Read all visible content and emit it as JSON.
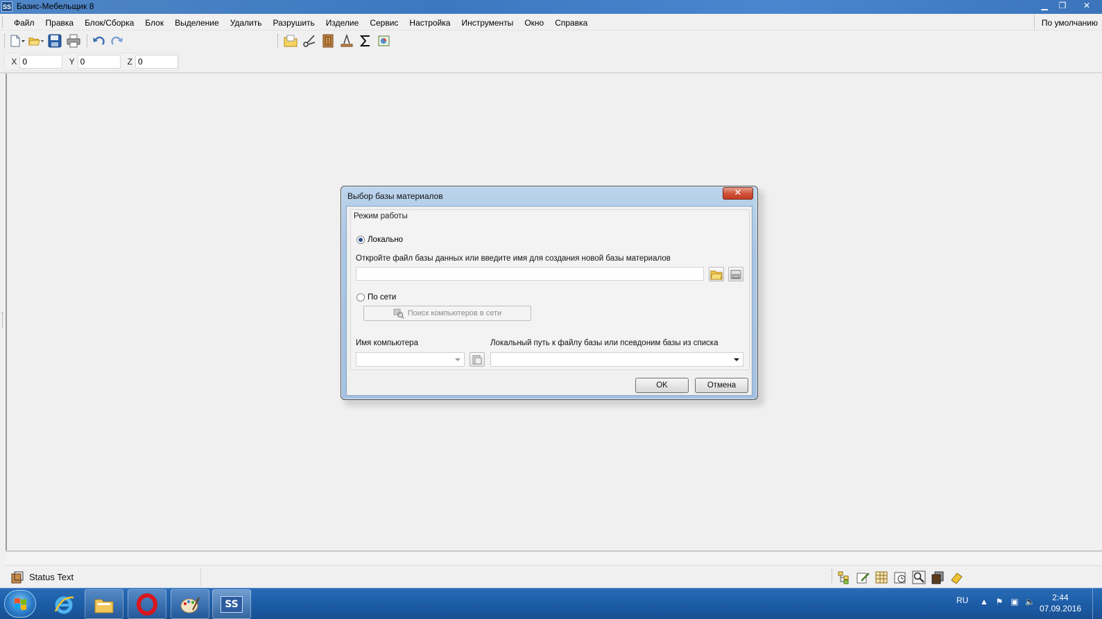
{
  "window": {
    "app_icon_text": "SS",
    "title": "Базис-Мебельщик 8",
    "minimize": "▁",
    "restore": "❐",
    "close": "✕"
  },
  "menu": {
    "items": [
      "Файл",
      "Правка",
      "Блок/Сборка",
      "Блок",
      "Выделение",
      "Удалить",
      "Разрушить",
      "Изделие",
      "Сервис",
      "Настройка",
      "Инструменты",
      "Окно",
      "Справка"
    ],
    "right_label": "По умолчанию"
  },
  "coords": {
    "x_label": "X",
    "x_value": "0",
    "y_label": "Y",
    "y_value": "0",
    "z_label": "Z",
    "z_value": "0"
  },
  "dialog": {
    "title": "Выбор базы материалов",
    "close_label": "✕",
    "group_title": "Режим работы",
    "local_label": "Локально",
    "local_selected": true,
    "open_file_label": "Откройте файл базы данных или введите имя для создания новой базы материалов",
    "file_value": "",
    "network_label": "По сети",
    "search_button": "Поиск компьютеров в сети",
    "computer_name_label": "Имя компьютера",
    "computer_value": "",
    "local_path_label": "Локальный путь к файлу базы или псевдоним базы из списка",
    "path_value": "",
    "ok_label": "OK",
    "cancel_label": "Отмена"
  },
  "statusbar": {
    "text": "Status Text"
  },
  "taskbar": {
    "language": "RU",
    "time": "2:44",
    "date": "07.09.2016",
    "sis_label": "SS"
  },
  "colors": {
    "titlebar": "#3c78c0",
    "taskbar": "#1c5da8",
    "dialog_frame": "#a9c6e5",
    "close_button": "#c13b22"
  }
}
